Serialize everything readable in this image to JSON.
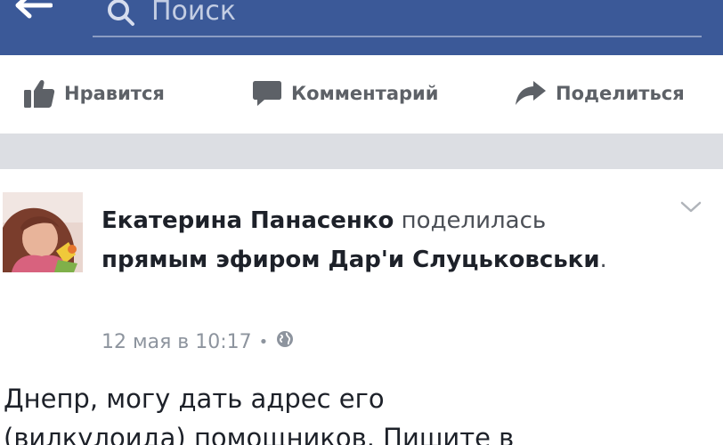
{
  "topbar": {
    "color": "#3b5998",
    "back_icon": "arrow-left-icon",
    "search_icon": "search-icon",
    "search_placeholder": "Поиск"
  },
  "actions": {
    "like": {
      "label": "Нравится",
      "icon": "thumbs-up-icon"
    },
    "comment": {
      "label": "Комментарий",
      "icon": "comment-bubble-icon"
    },
    "share": {
      "label": "Поделиться",
      "icon": "share-arrow-icon"
    }
  },
  "post": {
    "author": "Екатерина Панасенко",
    "verb": "поделилась",
    "target": "прямым эфиром Дар'и Слуцьковськи",
    "period": ".",
    "timestamp": "12 мая в 10:17",
    "separator": "•",
    "privacy_icon": "globe-icon",
    "menu_icon": "chevron-down-icon",
    "body_line_1": "Днепр, могу дать адрес его",
    "body_line_2": "(вилкулоида) помощников. Пишите в"
  }
}
